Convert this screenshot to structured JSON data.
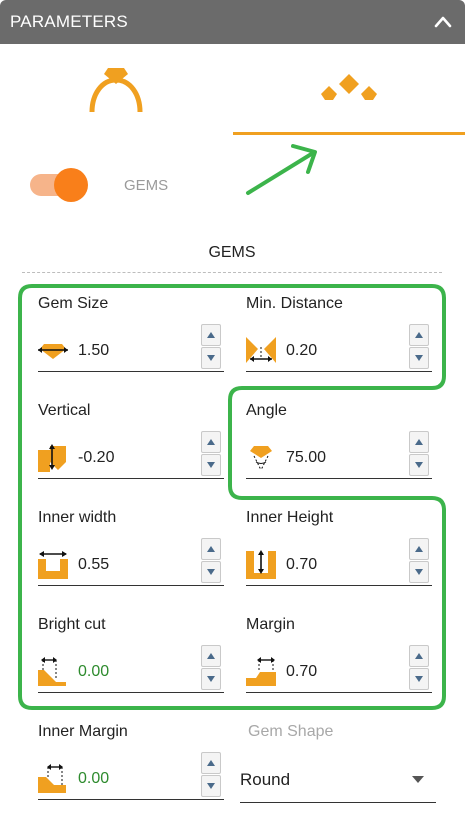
{
  "header": {
    "title": "PARAMETERS",
    "collapse_icon": "chevron-up-icon"
  },
  "tabs": [
    {
      "icon": "ring-icon",
      "active": false
    },
    {
      "icon": "gems-icon",
      "active": true
    }
  ],
  "toggle": {
    "label": "GEMS",
    "on": true
  },
  "section": {
    "title": "GEMS"
  },
  "fields": {
    "gem_size": {
      "label": "Gem Size",
      "value": "1.50",
      "icon": "gem-size-icon"
    },
    "min_distance": {
      "label": "Min. Distance",
      "value": "0.20",
      "icon": "min-distance-icon"
    },
    "vertical": {
      "label": "Vertical",
      "value": "-0.20",
      "icon": "vertical-icon"
    },
    "angle": {
      "label": "Angle",
      "value": "75.00",
      "icon": "angle-icon"
    },
    "inner_width": {
      "label": "Inner width",
      "value": "0.55",
      "icon": "inner-width-icon"
    },
    "inner_height": {
      "label": "Inner Height",
      "value": "0.70",
      "icon": "inner-height-icon"
    },
    "bright_cut": {
      "label": "Bright cut",
      "value": "0.00",
      "icon": "bright-cut-icon"
    },
    "margin": {
      "label": "Margin",
      "value": "0.70",
      "icon": "margin-icon"
    },
    "inner_margin": {
      "label": "Inner Margin",
      "value": "0.00",
      "icon": "inner-margin-icon"
    },
    "gem_shape": {
      "label": "Gem Shape",
      "value": "Round"
    }
  },
  "colors": {
    "accent": "#f0a020",
    "highlight": "#3cb44b",
    "header_bg": "#6b6b6b"
  }
}
